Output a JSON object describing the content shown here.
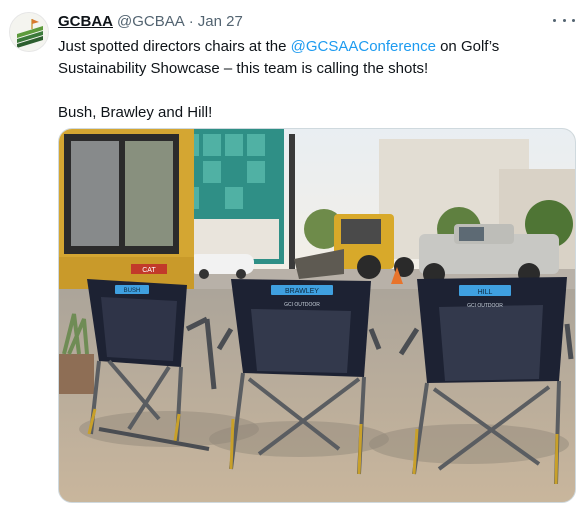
{
  "tweet": {
    "display_name": "GCBAA",
    "handle": "@GCBAA",
    "separator": "·",
    "date": "Jan 27",
    "text_line1_before": "Just spotted directors chairs at the ",
    "mention": "@GCSAAConference",
    "text_line1_after": " on Golf’s",
    "text_line2": "Sustainability Showcase – this team is calling the shots!",
    "text_line3": "Bush, Brawley and Hill!",
    "more_icon": "more-horizontal-icon"
  },
  "photo": {
    "chair_labels": [
      "BUSH",
      "BRAWLEY",
      "HILL"
    ],
    "chair_brand": "GCI OUTDOOR",
    "machine_label": "CAT"
  },
  "colors": {
    "link": "#1d9bf0",
    "secondary_text": "#536471",
    "chair_tag": "#3fa0e0"
  }
}
